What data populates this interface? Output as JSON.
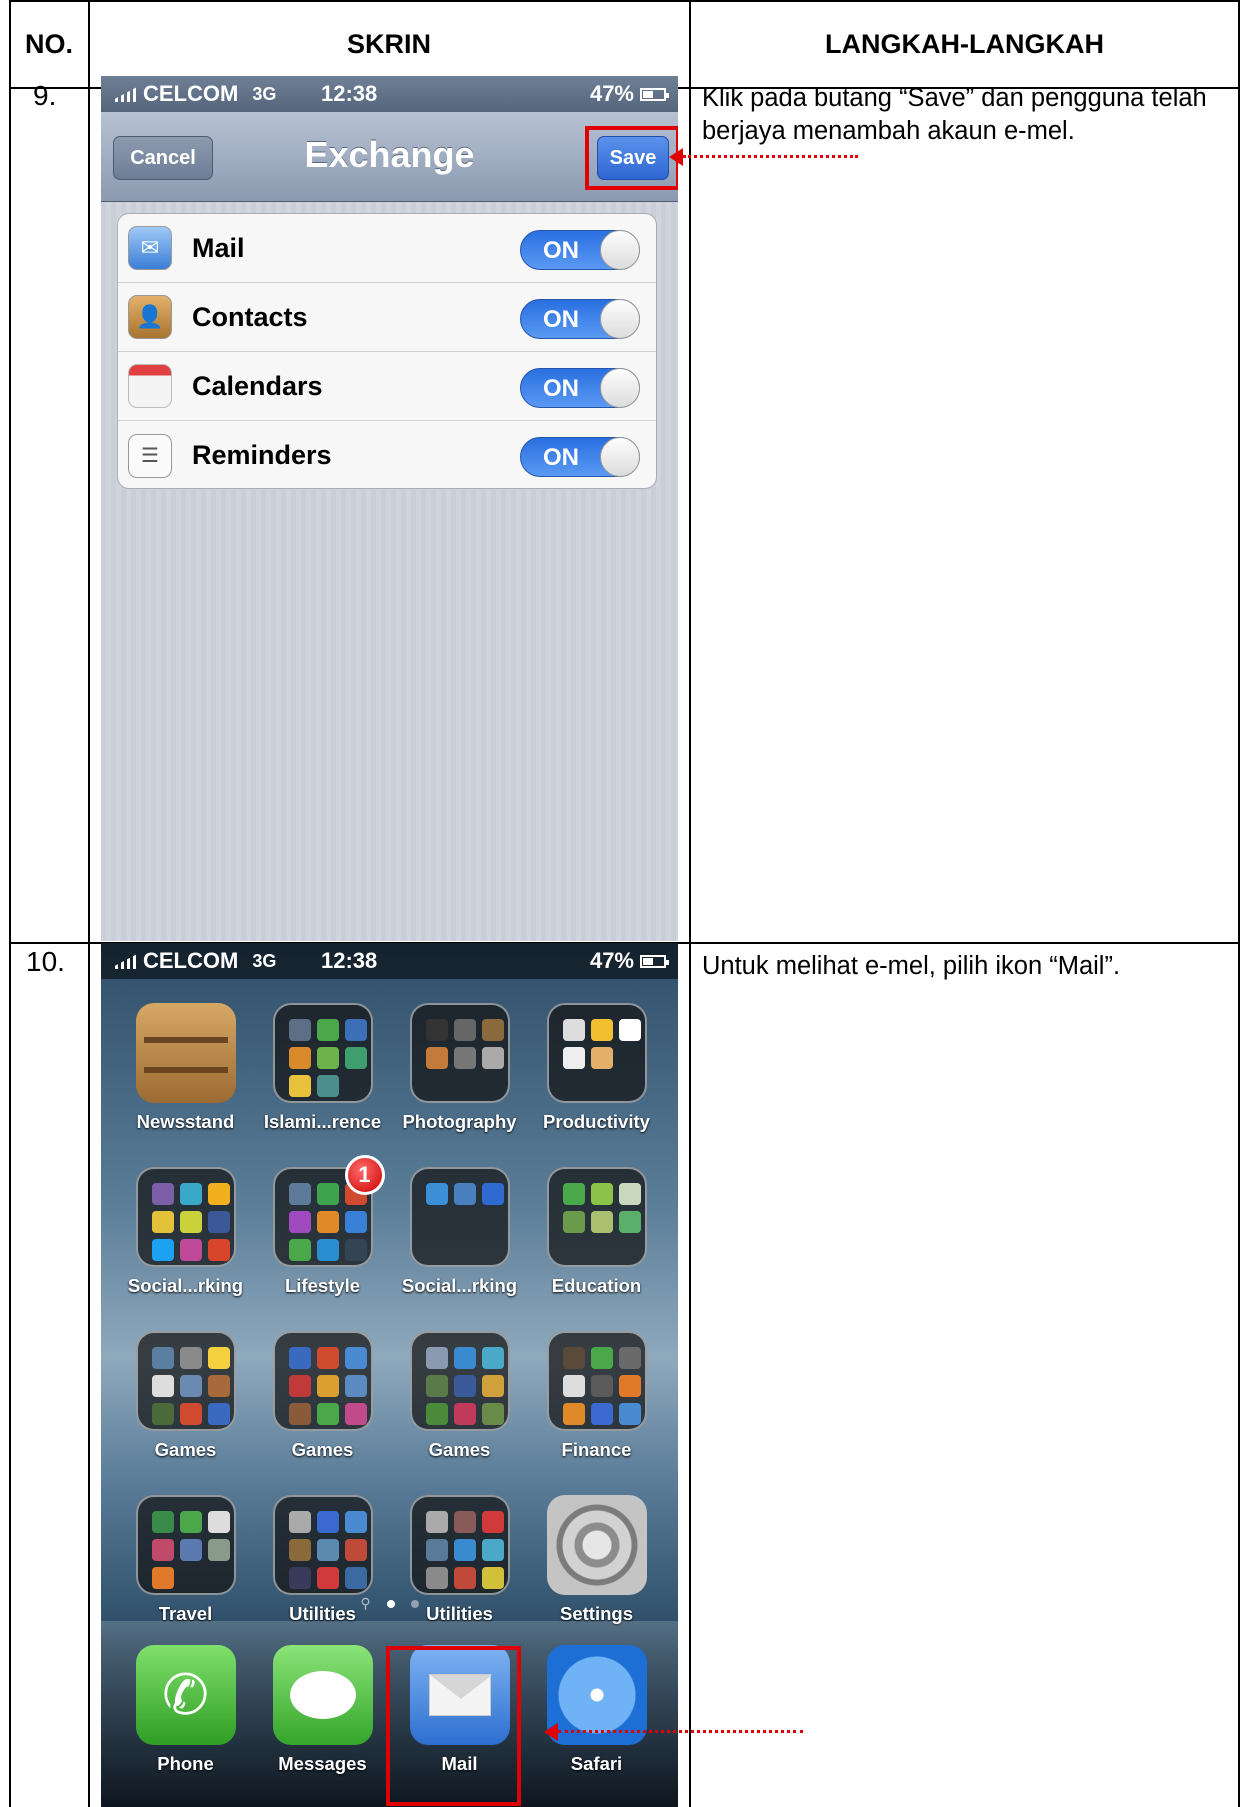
{
  "table": {
    "headers": {
      "no": "NO.",
      "screen": "SKRIN",
      "steps": "LANGKAH-LANGKAH"
    },
    "rows": [
      {
        "number": "9.",
        "description": "Klik pada butang “Save” dan pengguna telah berjaya menambah akaun e-mel."
      },
      {
        "number": "10.",
        "description": "Untuk melihat e-mel, pilih ikon “Mail”."
      }
    ]
  },
  "status_bar": {
    "carrier": "CELCOM",
    "network": "3G",
    "time": "12:38",
    "battery": "47%"
  },
  "exchange_screen": {
    "title": "Exchange",
    "cancel_label": "Cancel",
    "save_label": "Save",
    "settings": [
      {
        "label": "Mail",
        "icon": "mail-icon",
        "toggle": "ON"
      },
      {
        "label": "Contacts",
        "icon": "contacts-icon",
        "toggle": "ON"
      },
      {
        "label": "Calendars",
        "icon": "calendar-icon",
        "toggle": "ON"
      },
      {
        "label": "Reminders",
        "icon": "reminders-icon",
        "toggle": "ON"
      }
    ]
  },
  "home_screen": {
    "apps": [
      {
        "label": "Newsstand"
      },
      {
        "label": "Islami...rence"
      },
      {
        "label": "Photography"
      },
      {
        "label": "Productivity"
      },
      {
        "label": "Social...rking"
      },
      {
        "label": "Lifestyle",
        "badge": "1"
      },
      {
        "label": "Social...rking"
      },
      {
        "label": "Education"
      },
      {
        "label": "Games"
      },
      {
        "label": "Games"
      },
      {
        "label": "Games"
      },
      {
        "label": "Finance"
      },
      {
        "label": "Travel"
      },
      {
        "label": "Utilities"
      },
      {
        "label": "Utilities"
      },
      {
        "label": "Settings"
      }
    ],
    "dock": [
      {
        "label": "Phone"
      },
      {
        "label": "Messages"
      },
      {
        "label": "Mail"
      },
      {
        "label": "Safari"
      }
    ]
  },
  "colors": {
    "highlight": "#e00000",
    "toggle_on": "#2a6fe0",
    "nav_bar": "#8b9ab1"
  }
}
